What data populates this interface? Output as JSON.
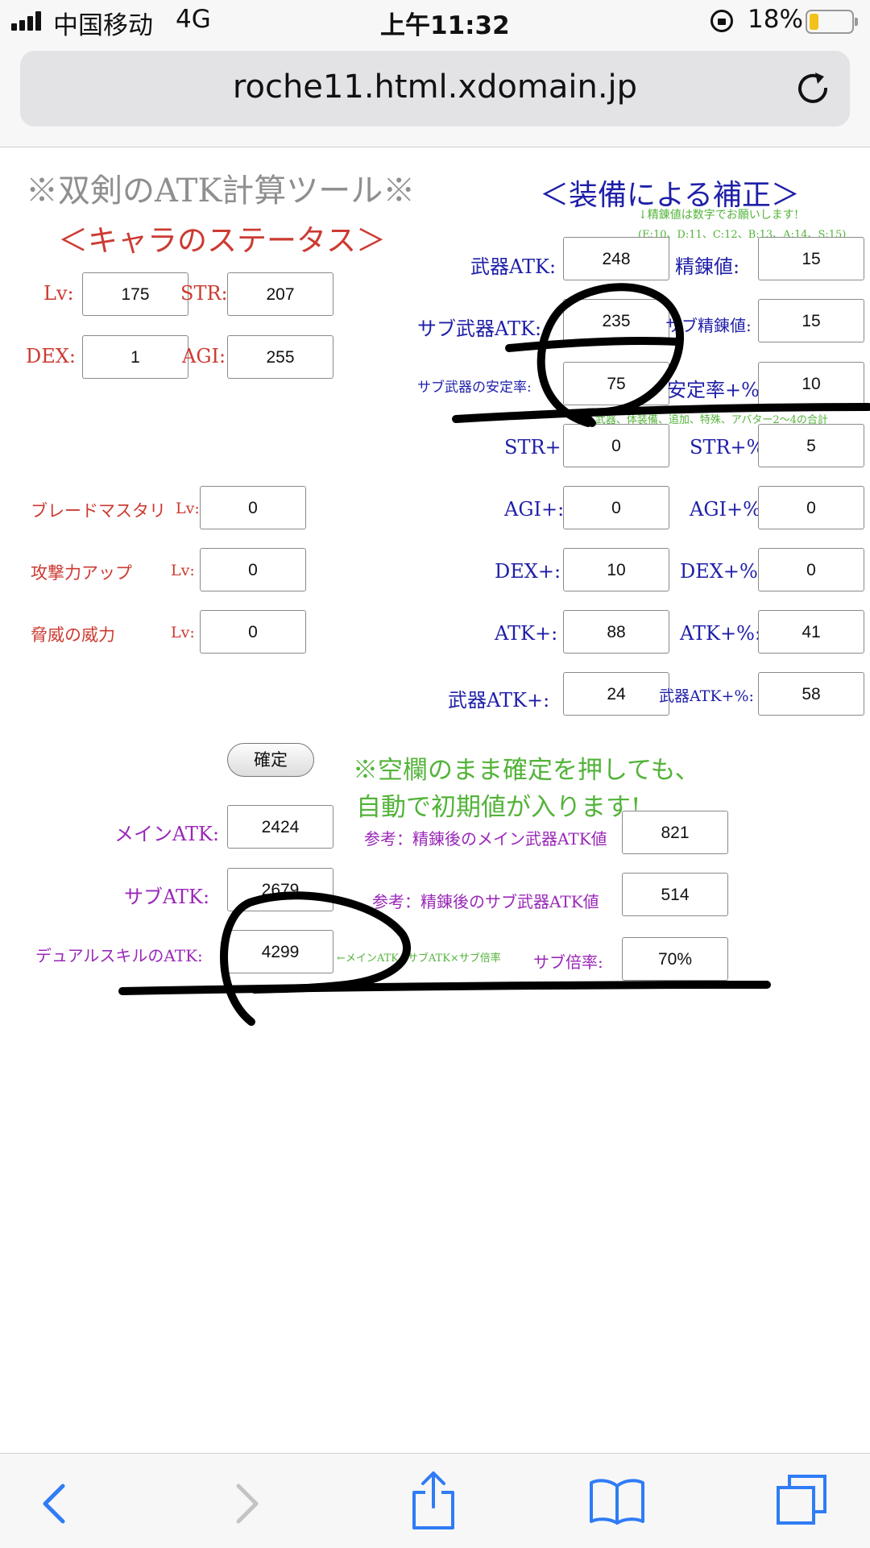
{
  "status_bar": {
    "carrier": "中国移动",
    "network": "4G",
    "time": "上午11:32",
    "battery": "18%"
  },
  "browser": {
    "url": "roche11.html.xdomain.jp"
  },
  "page": {
    "title": "※双剣のATK計算ツール※",
    "char_heading": "＜キャラのステータス＞",
    "equip_heading": "＜装備による補正＞",
    "refine_note_1": "↓精錬値は数字でお願いします!",
    "refine_note_2": "(E:10、D:11、C:12、B:13、A:14、S:15)",
    "sum_note": "↑武器、体装備、追加、特殊、アバター2〜4の合計",
    "char": {
      "lv_label": "Lv:",
      "lv": "175",
      "str_label": "STR:",
      "str": "207",
      "dex_label": "DEX:",
      "dex": "1",
      "agi_label": "AGI:",
      "agi": "255"
    },
    "skills": {
      "blade_label": "ブレードマスタリ",
      "blade_lv_label": "Lv:",
      "blade": "0",
      "atk_up_label": "攻撃力アップ",
      "atk_up_lv_label": "Lv:",
      "atk_up": "0",
      "threat_label": "脅威の威力",
      "threat_lv_label": "Lv:",
      "threat": "0"
    },
    "equip": {
      "weapon_atk_label": "武器ATK:",
      "weapon_atk": "248",
      "refine_label": "精錬値:",
      "refine": "15",
      "sub_weapon_atk_label": "サブ武器ATK:",
      "sub_weapon_atk": "235",
      "sub_refine_label": "サブ精錬値:",
      "sub_refine": "15",
      "sub_stability_label": "サブ武器の安定率:",
      "sub_stability": "75",
      "stability_pct_label": "安定率+%:",
      "stability_pct": "10",
      "str_plus_label": "STR+:",
      "str_plus": "0",
      "str_pct_label": "STR+%",
      "str_pct": "5",
      "agi_plus_label": "AGI+:",
      "agi_plus": "0",
      "agi_pct_label": "AGI+%",
      "agi_pct": "0",
      "dex_plus_label": "DEX+:",
      "dex_plus": "10",
      "dex_pct_label": "DEX+%:",
      "dex_pct": "0",
      "atk_plus_label": "ATK+:",
      "atk_plus": "88",
      "atk_pct_label": "ATK+%:",
      "atk_pct": "41",
      "weapon_atk_plus_label": "武器ATK+:",
      "weapon_atk_plus": "24",
      "weapon_atk_pct_label": "武器ATK+%:",
      "weapon_atk_pct": "58"
    },
    "confirm_button": "確定",
    "notice_line1": "※空欄のまま確定を押しても、",
    "notice_line2": "自動で初期値が入ります!",
    "results": {
      "main_atk_label": "メインATK:",
      "main_atk": "2424",
      "sub_atk_label": "サブATK:",
      "sub_atk": "2679",
      "dual_label": "デュアルスキルのATK:",
      "dual": "4299",
      "formula_note": "←メインATK+サブATK×サブ倍率",
      "ref_main_label": "参考：精錬後のメイン武器ATK値",
      "ref_main": "821",
      "ref_sub_label": "参考：精錬後のサブ武器ATK値",
      "ref_sub": "514",
      "sub_ratio_label": "サブ倍率:",
      "sub_ratio": "70%"
    }
  }
}
